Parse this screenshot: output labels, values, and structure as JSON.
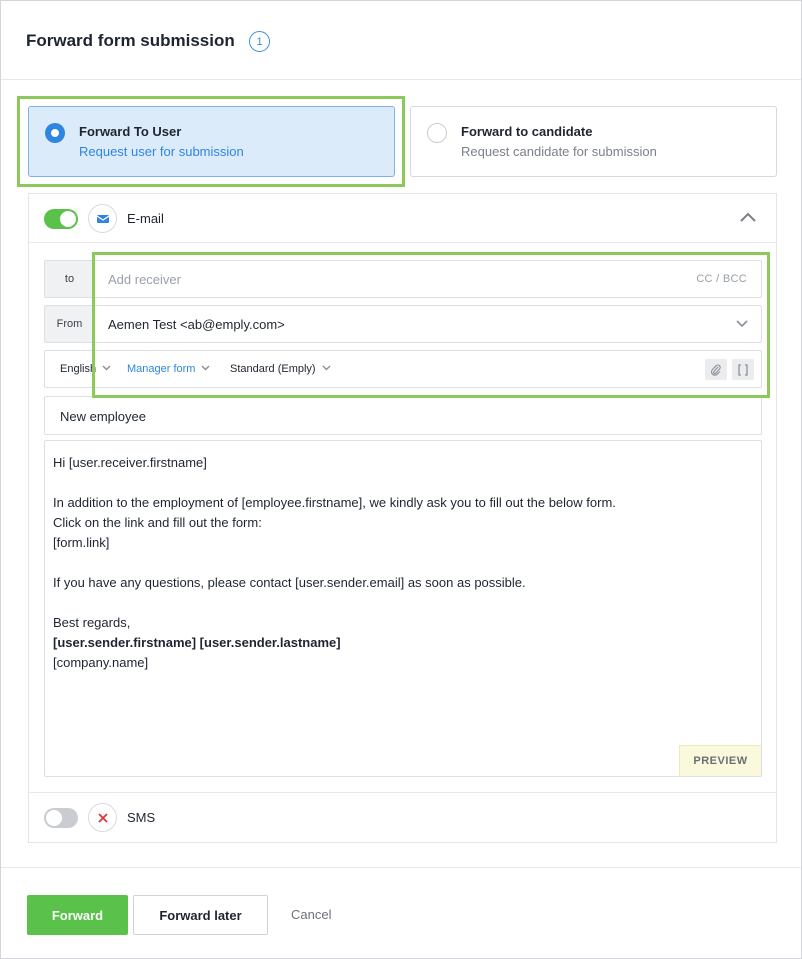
{
  "dialog": {
    "title": "Forward form submission",
    "step_badge": "1"
  },
  "options": [
    {
      "title": "Forward To User",
      "subtitle": "Request user for submission",
      "selected": true
    },
    {
      "title": "Forward to candidate",
      "subtitle": "Request candidate for submission",
      "selected": false
    }
  ],
  "email": {
    "enabled": true,
    "label": "E-mail",
    "icon": "envelope-icon",
    "to_label": "to",
    "to_placeholder": "Add receiver",
    "cc_bcc": "CC / BCC",
    "from_label": "From",
    "from_value": "Aemen Test <ab@emply.com>",
    "language": "English",
    "template": "Manager form",
    "signature": "Standard (Emply)",
    "subject": "New employee",
    "body": {
      "line1": "Hi [user.receiver.firstname]",
      "line2": "In addition to the employment of [employee.firstname], we kindly ask you to fill out the below form.",
      "line3": "Click on the link and fill out the form:",
      "line4": "[form.link]",
      "line5": "If you have any questions, please contact [user.sender.email] as soon as possible.",
      "line6": "Best regards,",
      "line7": "[user.sender.firstname] [user.sender.lastname]",
      "line8": "[company.name]"
    },
    "preview_label": "PREVIEW"
  },
  "sms": {
    "enabled": false,
    "label": "SMS",
    "icon": "close-icon"
  },
  "footer": {
    "forward_label": "Forward",
    "forward_later_label": "Forward later",
    "cancel_label": "Cancel"
  },
  "colors": {
    "accent_blue": "#2f86e0",
    "primary_green": "#5ac14a",
    "highlight_green": "#8cc95a",
    "selected_bg": "#dcebfa"
  }
}
